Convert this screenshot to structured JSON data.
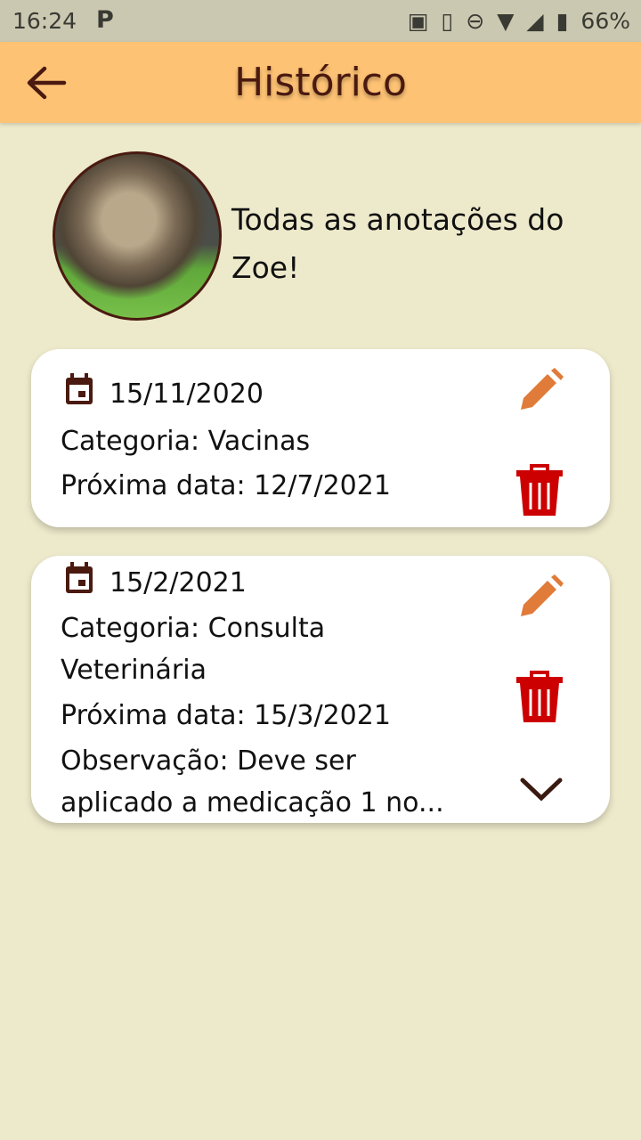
{
  "status_bar": {
    "time": "16:24",
    "app_icon": "P",
    "battery": "66%"
  },
  "app_bar": {
    "title": "Histórico"
  },
  "header": {
    "text": "Todas as anotações do Zoe!"
  },
  "entries": [
    {
      "date": "15/11/2020",
      "category": "Categoria: Vacinas",
      "next_date": "Próxima data: 12/7/2021"
    },
    {
      "date": "15/2/2021",
      "category_line1": "Categoria: Consulta",
      "category_line2": "Veterinária",
      "next_date": "Próxima data: 15/3/2021",
      "obs_line1": "Observação: Deve ser",
      "obs_line2": "aplicado a medicação 1 no..."
    }
  ],
  "colors": {
    "appbar": "#fdc274",
    "background": "#ede9cb",
    "edit": "#e07b39",
    "delete": "#cc0000",
    "dark": "#4a1a10"
  }
}
